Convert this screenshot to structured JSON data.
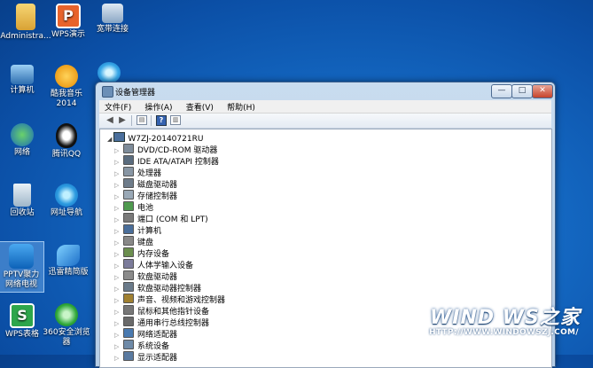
{
  "desktop": {
    "icons": [
      {
        "label": "Administra..."
      },
      {
        "label": "WPS演示"
      },
      {
        "label": "宽带连接"
      },
      {
        "label": "计算机"
      },
      {
        "label": "酷我音乐 2014"
      },
      {
        "label": "网络"
      },
      {
        "label": "腾讯QQ"
      },
      {
        "label": "回收站"
      },
      {
        "label": "网址导航"
      },
      {
        "label": "PPTV聚力 网络电视"
      },
      {
        "label": "迅雷精简版"
      },
      {
        "label": "WPS表格"
      },
      {
        "label": "360安全浏览器"
      }
    ]
  },
  "window": {
    "title": "设备管理器",
    "controls": {
      "minimize": "—",
      "maximize": "□",
      "close": "✕"
    },
    "menu": [
      "文件(F)",
      "操作(A)",
      "查看(V)",
      "帮助(H)"
    ],
    "tree": {
      "root": "W7ZJ-20140721RU",
      "items": [
        "DVD/CD-ROM 驱动器",
        "IDE ATA/ATAPI 控制器",
        "处理器",
        "磁盘驱动器",
        "存储控制器",
        "电池",
        "端口 (COM 和 LPT)",
        "计算机",
        "键盘",
        "内存设备",
        "人体学输入设备",
        "软盘驱动器",
        "软盘驱动器控制器",
        "声音、视频和游戏控制器",
        "鼠标和其他指针设备",
        "通用串行总线控制器",
        "网络适配器",
        "系统设备",
        "显示适配器"
      ]
    }
  },
  "watermark": {
    "logo": "WIND WS之家",
    "url": "HTTP://WWW.WINDOWSZJ.COM/"
  }
}
